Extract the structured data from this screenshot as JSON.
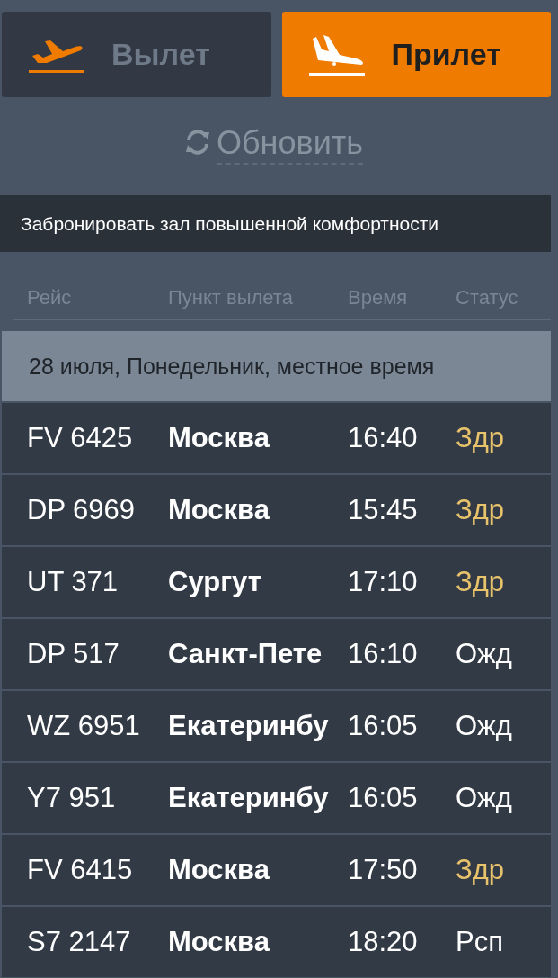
{
  "tabs": [
    {
      "label": "Вылет",
      "selected": false,
      "kind": "departure"
    },
    {
      "label": "Прилет",
      "selected": true,
      "kind": "arrival"
    }
  ],
  "refresh": {
    "label": "Обновить"
  },
  "banner": {
    "label": "Забронировать зал повышенной комфортности"
  },
  "table": {
    "columns": [
      "Рейс",
      "Пункт вылета",
      "Время",
      "Статус"
    ],
    "date_header": "28 июля, Понедельник, местное время",
    "rows": [
      {
        "flight": "FV 6425",
        "city": "Москва",
        "time": "16:40",
        "status": "Здр",
        "color": "#e8c36c"
      },
      {
        "flight": "DP 6969",
        "city": "Москва",
        "time": "15:45",
        "status": "Здр",
        "color": "#e8c36c"
      },
      {
        "flight": "UT 371",
        "city": "Сургут",
        "time": "17:10",
        "status": "Здр",
        "color": "#e8c36c"
      },
      {
        "flight": "DP 517",
        "city": "Санкт-Пете",
        "time": "16:10",
        "status": "Ожд",
        "color": "#ffffff"
      },
      {
        "flight": "WZ 6951",
        "city": "Екатеринбу",
        "time": "16:05",
        "status": "Ожд",
        "color": "#ffffff"
      },
      {
        "flight": "Y7 951",
        "city": "Екатеринбу",
        "time": "16:05",
        "status": "Ожд",
        "color": "#ffffff"
      },
      {
        "flight": "FV 6415",
        "city": "Москва",
        "time": "17:50",
        "status": "Здр",
        "color": "#e8c36c"
      },
      {
        "flight": "S7 2147",
        "city": "Москва",
        "time": "18:20",
        "status": "Рсп",
        "color": "#ffffff"
      }
    ]
  }
}
